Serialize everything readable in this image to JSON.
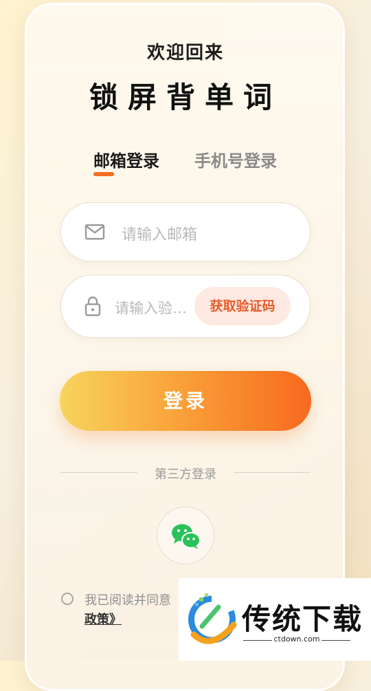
{
  "header": {
    "welcome": "欢迎回来",
    "app_title": "锁屏背单词"
  },
  "tabs": [
    {
      "label": "邮箱登录",
      "active": true
    },
    {
      "label": "手机号登录",
      "active": false
    }
  ],
  "form": {
    "email_placeholder": "请输入邮箱",
    "code_placeholder": "请输入验证码",
    "get_code_label": "获取验证码",
    "login_label": "登录"
  },
  "third_party": {
    "label": "第三方登录",
    "providers": [
      {
        "icon": "wechat-icon"
      }
    ]
  },
  "agreement": {
    "text": "我已阅读并同意",
    "policy": "政策》"
  },
  "watermark": {
    "name": "传统下载",
    "url": "ctdown.com"
  },
  "colors": {
    "accent": "#f26f22",
    "button_start": "#f7d45d",
    "button_end": "#f8691f",
    "wechat": "#2ac25a"
  }
}
